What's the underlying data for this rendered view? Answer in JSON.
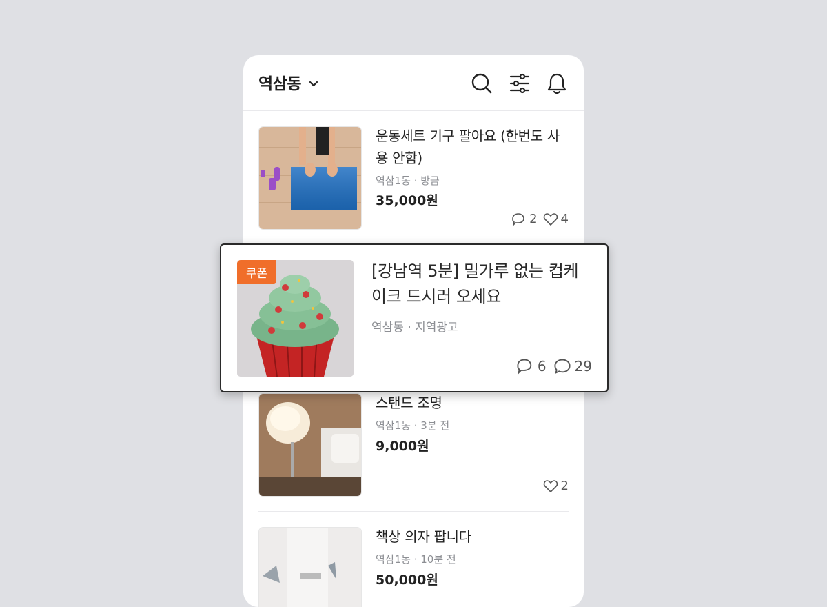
{
  "header": {
    "location": "역삼동",
    "icons": [
      "search-icon",
      "filter-icon",
      "bell-icon"
    ]
  },
  "listings": [
    {
      "title": "운동세트 기구 팔아요 (한번도 사용 안함)",
      "meta": "역삼1동 · 방금",
      "price": "35,000원",
      "chats": "2",
      "likes": "4"
    },
    {
      "title": "스탠드 조명",
      "meta": "역삼1동 · 3분 전",
      "price": "9,000원",
      "likes": "2"
    },
    {
      "title": "책상 의자 팝니다",
      "meta": "역삼1동 · 10분 전",
      "price": "50,000원"
    }
  ],
  "ad_card": {
    "badge": "쿠폰",
    "title": "[강남역 5분] 밀가루 없는 컵케이크 드시러 오세요",
    "meta": "역삼동 · 지역광고",
    "chats": "6",
    "comments": "29",
    "accent_color": "#f06e2a"
  }
}
